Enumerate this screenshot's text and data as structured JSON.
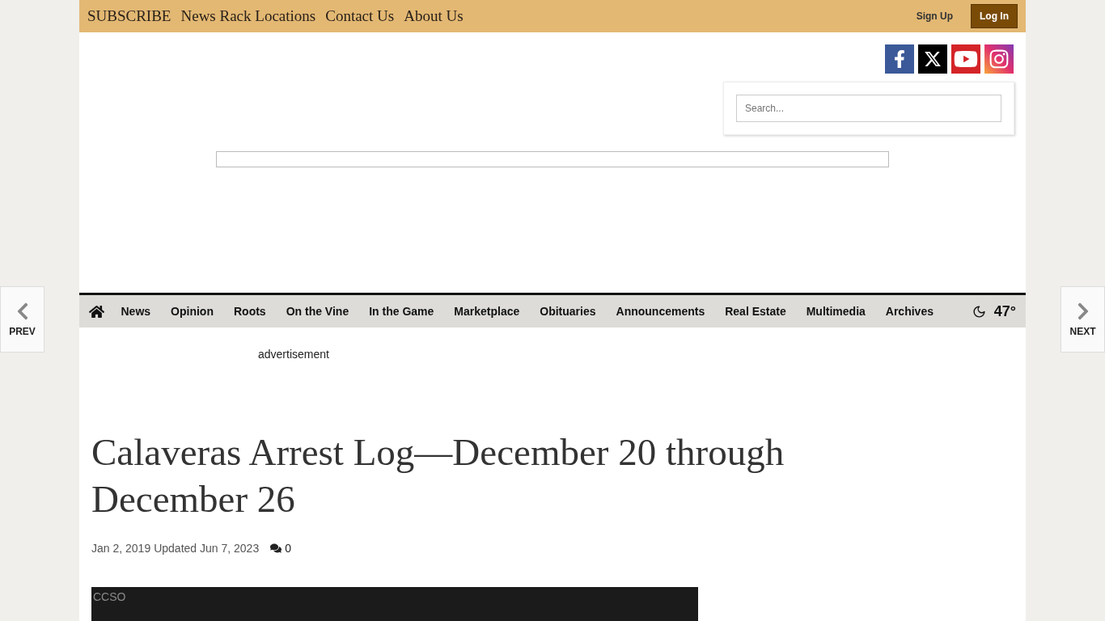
{
  "top_links": [
    "SUBSCRIBE",
    "News Rack Locations",
    "Contact Us",
    "About Us"
  ],
  "account": {
    "sign_up": "Sign Up",
    "log_in": "Log In"
  },
  "search": {
    "placeholder": "Search..."
  },
  "nav": {
    "items": [
      "News",
      "Opinion",
      "Roots",
      "On the Vine",
      "In the Game",
      "Marketplace",
      "Obituaries",
      "Announcements",
      "Real Estate",
      "Multimedia",
      "Archives"
    ],
    "temperature": "47°"
  },
  "ad": {
    "alt": "advertisement"
  },
  "article": {
    "title": "Calaveras Arrest Log—December 20 through December 26",
    "date": "Jan 2, 2019",
    "updated": "Updated Jun 7, 2023",
    "comments": "0",
    "image_alt": "CCSO"
  },
  "pager": {
    "prev": "PREV",
    "next": "NEXT"
  }
}
